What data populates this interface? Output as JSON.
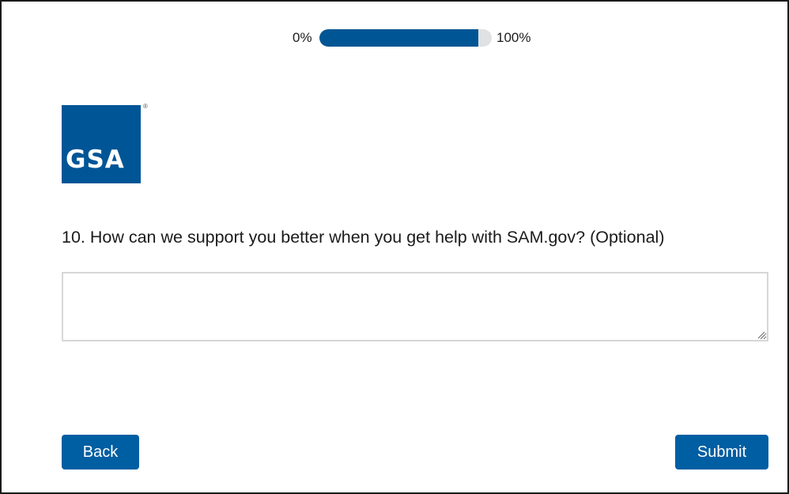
{
  "progress": {
    "min_label": "0%",
    "max_label": "100%",
    "percent": 92
  },
  "logo": {
    "text": "GSA",
    "registered_mark": "®",
    "color": "#005596"
  },
  "question": {
    "text": "10. How can we support you better when you get help with SAM.gov? (Optional)",
    "answer_value": "",
    "answer_placeholder": ""
  },
  "buttons": {
    "back_label": "Back",
    "submit_label": "Submit",
    "color": "#005ea2"
  },
  "icons": {
    "resize": "resize-grip-icon"
  }
}
